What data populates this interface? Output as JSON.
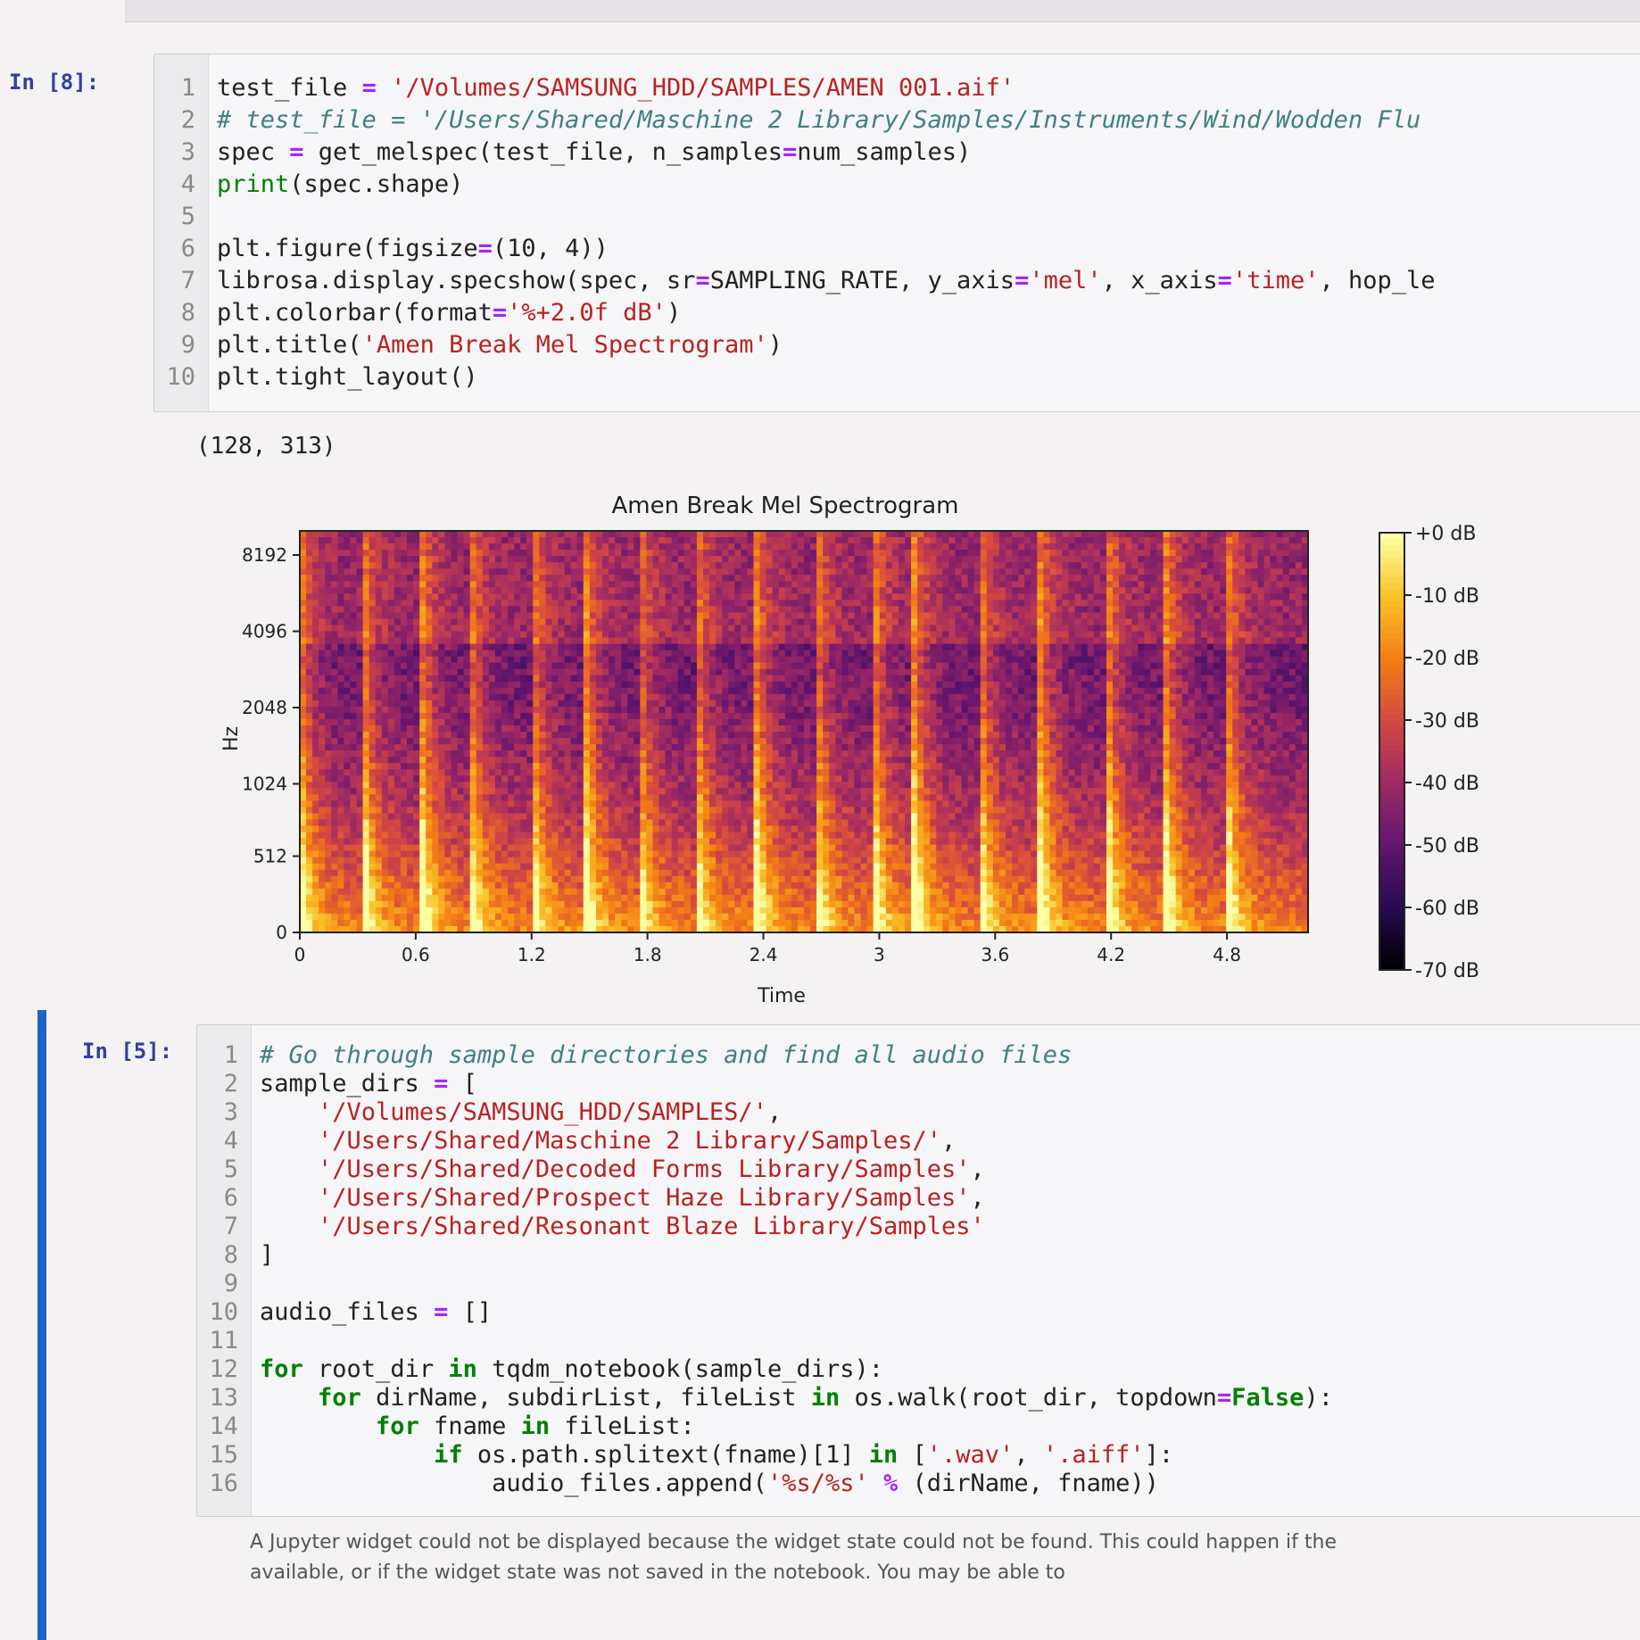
{
  "cell1": {
    "prompt": "In [8]:",
    "lines": [
      {
        "n": "1",
        "tokens": [
          [
            "txt",
            "test_file "
          ],
          [
            "op",
            "="
          ],
          [
            "txt",
            " "
          ],
          [
            "str",
            "'/Volumes/SAMSUNG_HDD/SAMPLES/AMEN 001.aif'"
          ]
        ]
      },
      {
        "n": "2",
        "tokens": [
          [
            "cm",
            "# test_file = '/Users/Shared/Maschine 2 Library/Samples/Instruments/Wind/Wodden Flu"
          ]
        ]
      },
      {
        "n": "3",
        "tokens": [
          [
            "txt",
            "spec "
          ],
          [
            "op",
            "="
          ],
          [
            "txt",
            " get_melspec(test_file, n_samples"
          ],
          [
            "op",
            "="
          ],
          [
            "txt",
            "num_samples)"
          ]
        ]
      },
      {
        "n": "4",
        "tokens": [
          [
            "bi",
            "print"
          ],
          [
            "txt",
            "(spec.shape)"
          ]
        ]
      },
      {
        "n": "5",
        "tokens": []
      },
      {
        "n": "6",
        "tokens": [
          [
            "txt",
            "plt.figure(figsize"
          ],
          [
            "op",
            "="
          ],
          [
            "txt",
            "(10, 4))"
          ]
        ]
      },
      {
        "n": "7",
        "tokens": [
          [
            "txt",
            "librosa.display.specshow(spec, sr"
          ],
          [
            "op",
            "="
          ],
          [
            "txt",
            "SAMPLING_RATE, y_axis"
          ],
          [
            "op",
            "="
          ],
          [
            "str",
            "'mel'"
          ],
          [
            "txt",
            ", x_axis"
          ],
          [
            "op",
            "="
          ],
          [
            "str",
            "'time'"
          ],
          [
            "txt",
            ", hop_le"
          ]
        ]
      },
      {
        "n": "8",
        "tokens": [
          [
            "txt",
            "plt.colorbar(format"
          ],
          [
            "op",
            "="
          ],
          [
            "str",
            "'%+2.0f dB'"
          ],
          [
            "txt",
            ")"
          ]
        ]
      },
      {
        "n": "9",
        "tokens": [
          [
            "txt",
            "plt.title("
          ],
          [
            "str",
            "'Amen Break Mel Spectrogram'"
          ],
          [
            "txt",
            ")"
          ]
        ]
      },
      {
        "n": "10",
        "tokens": [
          [
            "txt",
            "plt.tight_layout()"
          ]
        ]
      }
    ],
    "output_text": "(128, 313)"
  },
  "chart_data": {
    "type": "heatmap",
    "title": "Amen Break Mel Spectrogram",
    "xlabel": "Time",
    "ylabel": "Hz",
    "x_ticks": [
      "0",
      "0.6",
      "1.2",
      "1.8",
      "2.4",
      "3",
      "3.6",
      "4.2",
      "4.8"
    ],
    "x_tick_values": [
      0,
      0.6,
      1.2,
      1.8,
      2.4,
      3,
      3.6,
      4.2,
      4.8
    ],
    "xlim": [
      0,
      5.22
    ],
    "y_ticks": [
      "0",
      "512",
      "1024",
      "2048",
      "4096",
      "8192"
    ],
    "y_scale": "mel",
    "colorbar": {
      "ticks": [
        "+0 dB",
        "-10 dB",
        "-20 dB",
        "-30 dB",
        "-40 dB",
        "-50 dB",
        "-60 dB",
        "-70 dB"
      ],
      "range": [
        -70,
        0
      ],
      "colormap": [
        "#000004",
        "#280b54",
        "#65156e",
        "#9f2a63",
        "#d44842",
        "#f57d15",
        "#fac228",
        "#fcffa4"
      ]
    },
    "shape": [
      128,
      313
    ],
    "onsets": [
      0.0,
      0.33,
      0.63,
      0.88,
      1.2,
      1.48,
      1.75,
      2.05,
      2.36,
      2.67,
      2.97,
      3.18,
      3.52,
      3.83,
      4.18,
      4.48,
      4.8
    ]
  },
  "cell2": {
    "prompt": "In [5]:",
    "lines": [
      {
        "n": "1",
        "tokens": [
          [
            "cm",
            "# Go through sample directories and find all audio files"
          ]
        ]
      },
      {
        "n": "2",
        "tokens": [
          [
            "txt",
            "sample_dirs "
          ],
          [
            "op",
            "="
          ],
          [
            "txt",
            " ["
          ]
        ]
      },
      {
        "n": "3",
        "tokens": [
          [
            "txt",
            "    "
          ],
          [
            "str",
            "'/Volumes/SAMSUNG_HDD/SAMPLES/'"
          ],
          [
            "txt",
            ","
          ]
        ]
      },
      {
        "n": "4",
        "tokens": [
          [
            "txt",
            "    "
          ],
          [
            "str",
            "'/Users/Shared/Maschine 2 Library/Samples/'"
          ],
          [
            "txt",
            ","
          ]
        ]
      },
      {
        "n": "5",
        "tokens": [
          [
            "txt",
            "    "
          ],
          [
            "str",
            "'/Users/Shared/Decoded Forms Library/Samples'"
          ],
          [
            "txt",
            ","
          ]
        ]
      },
      {
        "n": "6",
        "tokens": [
          [
            "txt",
            "    "
          ],
          [
            "str",
            "'/Users/Shared/Prospect Haze Library/Samples'"
          ],
          [
            "txt",
            ","
          ]
        ]
      },
      {
        "n": "7",
        "tokens": [
          [
            "txt",
            "    "
          ],
          [
            "str",
            "'/Users/Shared/Resonant Blaze Library/Samples'"
          ]
        ]
      },
      {
        "n": "8",
        "tokens": [
          [
            "txt",
            "]"
          ]
        ]
      },
      {
        "n": "9",
        "tokens": []
      },
      {
        "n": "10",
        "tokens": [
          [
            "txt",
            "audio_files "
          ],
          [
            "op",
            "="
          ],
          [
            "txt",
            " []"
          ]
        ]
      },
      {
        "n": "11",
        "tokens": []
      },
      {
        "n": "12",
        "tokens": [
          [
            "kw",
            "for"
          ],
          [
            "txt",
            " root_dir "
          ],
          [
            "kw",
            "in"
          ],
          [
            "txt",
            " tqdm_notebook(sample_dirs):"
          ]
        ]
      },
      {
        "n": "13",
        "tokens": [
          [
            "txt",
            "    "
          ],
          [
            "kw",
            "for"
          ],
          [
            "txt",
            " dirName, subdirList, fileList "
          ],
          [
            "kw",
            "in"
          ],
          [
            "txt",
            " os.walk(root_dir, topdown"
          ],
          [
            "op",
            "="
          ],
          [
            "kw",
            "False"
          ],
          [
            "txt",
            "):"
          ]
        ]
      },
      {
        "n": "14",
        "tokens": [
          [
            "txt",
            "        "
          ],
          [
            "kw",
            "for"
          ],
          [
            "txt",
            " fname "
          ],
          [
            "kw",
            "in"
          ],
          [
            "txt",
            " fileList:"
          ]
        ]
      },
      {
        "n": "15",
        "tokens": [
          [
            "txt",
            "            "
          ],
          [
            "kw",
            "if"
          ],
          [
            "txt",
            " os.path.splitext(fname)[1] "
          ],
          [
            "kw",
            "in"
          ],
          [
            "txt",
            " ["
          ],
          [
            "str",
            "'.wav'"
          ],
          [
            "txt",
            ", "
          ],
          [
            "str",
            "'.aiff'"
          ],
          [
            "txt",
            "]:"
          ]
        ]
      },
      {
        "n": "16",
        "tokens": [
          [
            "txt",
            "                audio_files.append("
          ],
          [
            "str",
            "'%s/%s'"
          ],
          [
            "txt",
            " "
          ],
          [
            "op",
            "%"
          ],
          [
            "txt",
            " (dirName, fname))"
          ]
        ]
      }
    ],
    "widget_message_1": "A Jupyter widget could not be displayed because the widget state could not be found. This could happen if the",
    "widget_message_2": "available, or if the widget state was not saved in the notebook. You may be able to"
  }
}
